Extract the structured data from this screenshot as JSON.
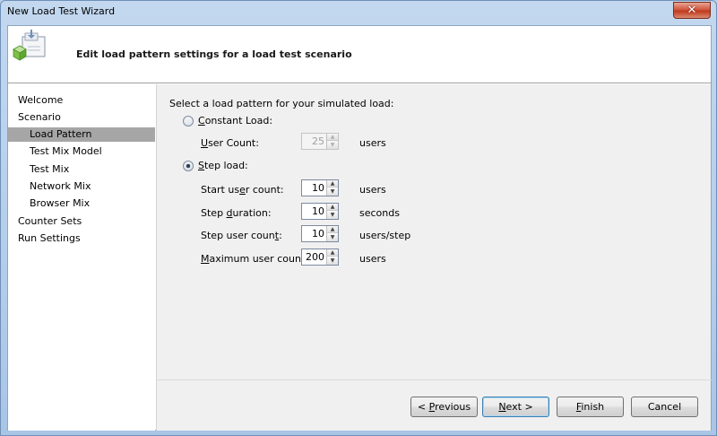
{
  "window": {
    "title": "New Load Test Wizard",
    "close_symbol": "✕"
  },
  "header": {
    "title": "Edit load pattern settings for a load test scenario",
    "icon": "wizard-document-cube-icon"
  },
  "sidebar": {
    "items": [
      {
        "label": "Welcome",
        "level": 0,
        "selected": false
      },
      {
        "label": "Scenario",
        "level": 0,
        "selected": false
      },
      {
        "label": "Load Pattern",
        "level": 1,
        "selected": true
      },
      {
        "label": "Test Mix Model",
        "level": 1,
        "selected": false
      },
      {
        "label": "Test Mix",
        "level": 1,
        "selected": false
      },
      {
        "label": "Network Mix",
        "level": 1,
        "selected": false
      },
      {
        "label": "Browser Mix",
        "level": 1,
        "selected": false
      },
      {
        "label": "Counter Sets",
        "level": 0,
        "selected": false
      },
      {
        "label": "Run Settings",
        "level": 0,
        "selected": false
      }
    ]
  },
  "content": {
    "prompt": "Select a load pattern for your simulated load:",
    "constant": {
      "label_mnemonic": "C",
      "label_rest": "onstant Load:",
      "selected": false,
      "user_count_mnemonic": "U",
      "user_count_rest": "ser Count:",
      "user_count_value": "25",
      "user_count_unit": "users"
    },
    "step": {
      "label_mnemonic": "S",
      "label_rest": "tep load:",
      "selected": true,
      "fields": [
        {
          "pre": "Start us",
          "mn": "e",
          "post": "r count:",
          "value": "10",
          "unit": "users"
        },
        {
          "pre": "Step ",
          "mn": "d",
          "post": "uration:",
          "value": "10",
          "unit": "seconds"
        },
        {
          "pre": "Step user coun",
          "mn": "t",
          "post": ":",
          "value": "10",
          "unit": "users/step"
        },
        {
          "pre": "",
          "mn": "M",
          "post": "aximum user count:",
          "value": "200",
          "unit": "users"
        }
      ]
    }
  },
  "buttons": {
    "previous_prefix": "< ",
    "previous_mn": "P",
    "previous_rest": "revious",
    "next_mn": "N",
    "next_rest": "ext >",
    "finish_mn": "F",
    "finish_rest": "inish",
    "cancel": "Cancel"
  },
  "colors": {
    "selected_nav": "#a6a6a6",
    "content_bg": "#f0f0f0",
    "titlebar": "#b9d1ea"
  }
}
